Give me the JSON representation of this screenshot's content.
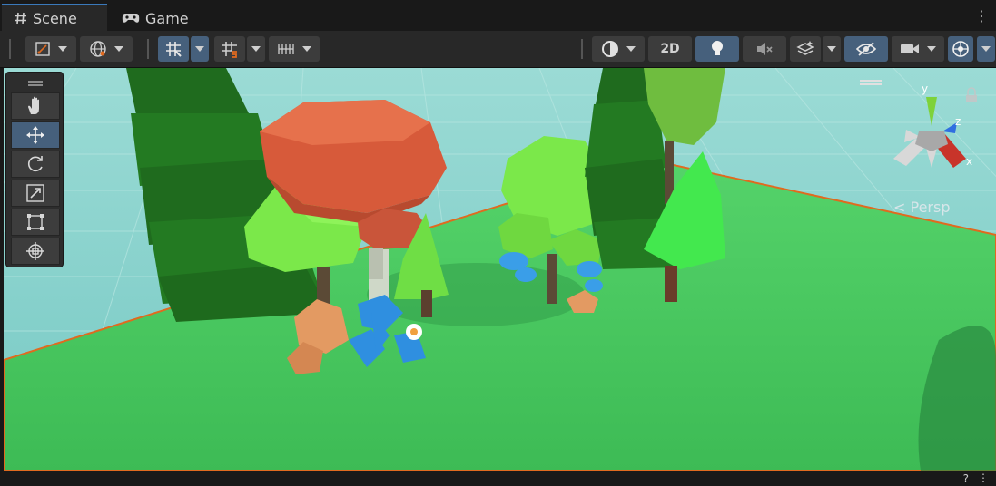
{
  "tabs": [
    {
      "label": "Scene",
      "icon": "hash-icon",
      "active": true
    },
    {
      "label": "Game",
      "icon": "gamepad-icon",
      "active": false
    }
  ],
  "toolbar": {
    "toggle_2d_label": "2D"
  },
  "scene_view": {
    "camera_mode_label": "< Persp",
    "axes": {
      "y": "y",
      "z": "z",
      "x": "x"
    }
  },
  "status_bar": {
    "help_label": "?"
  },
  "colors": {
    "selection_outline": "#e06a1f",
    "accent_blue": "#3a79bb",
    "ground": "#3fc85e",
    "sky": "#8ed6d2"
  }
}
